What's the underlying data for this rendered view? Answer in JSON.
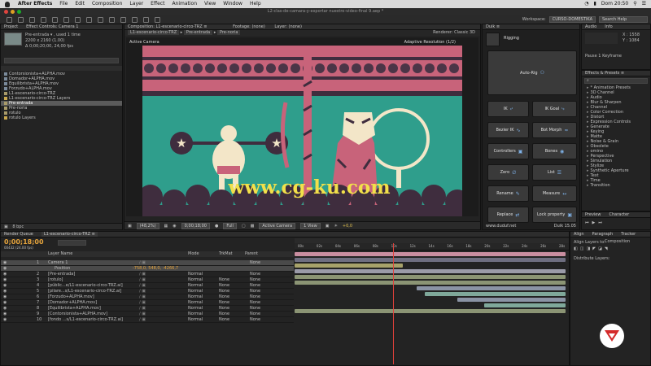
{
  "menubar": {
    "app": "After Effects",
    "items": [
      "File",
      "Edit",
      "Composition",
      "Layer",
      "Effect",
      "Animation",
      "View",
      "Window",
      "Help"
    ],
    "clock": "Dom 20:50"
  },
  "titlebar": {
    "title": "L2-clas-de-camara-y-exportar nuestro-video-final 9.aep *"
  },
  "toolbar": {
    "workspace_label": "Workspace:",
    "workspace_value": "CURSO-DOMESTIKA",
    "search_placeholder": "Search Help"
  },
  "project": {
    "tab_project": "Project",
    "tab_controls": "Effect Controls: Camera 1",
    "item_name": "Pre-entrada ▾ , used 1 time",
    "item_size": "2200 x 2160 (1.00)",
    "item_dur": "Δ 0;00;20;00, 24,00 fps",
    "items": [
      "Contorsionista+ALPHA.mov",
      "Domador+ALPHA.mov",
      "Equilibrista+ALPHA.mov",
      "Forzudo+ALPHA.mov",
      "L1-escenario-circo-TRZ",
      "L1-escenario-circo-TRZ Layers",
      "Pre-entrada",
      "Pre-noria",
      "rotulo",
      "rotulo Layers"
    ],
    "bpc": "8 bpc"
  },
  "comp": {
    "tab": "Composition: L1-escenario-circo-TRZ ≡",
    "tab2": "Footage: (none)",
    "tab3": "Layer: (none)",
    "breadcrumb1": "L1-escenario-circo-TRZ",
    "breadcrumb2": "Pre-entrada",
    "breadcrumb3": "Pre-noria",
    "renderer": "Renderer: Classic 3D",
    "active_camera": "Active Camera",
    "adaptive": "Adaptive Resolution (1/2)",
    "watermark": "www.cg-ku.com",
    "zoom": "(48,2%)",
    "timecode": "0;00;18;00",
    "quality": "Full",
    "view_camera": "Active Camera",
    "views": "1 View",
    "exposure": "+0,0"
  },
  "duik": {
    "tab": "Duik ≡",
    "section": "Rigging",
    "autorig": "Auto-Rig",
    "ik": "IK",
    "ikgoal": "IK Goal",
    "bezierik": "Bezier IK",
    "botmorph": "Bot Morph",
    "controllers": "Controllers",
    "bones": "Bones",
    "zero": "Zero",
    "list": "List",
    "rename": "Rename",
    "measure": "Measure",
    "replace": "Replace",
    "lockprop": "Lock property",
    "site": "www.duduf.net",
    "version": "Duik 15.05"
  },
  "info": {
    "tab_audio": "Audio",
    "tab_info": "Info",
    "x": "X : 1558",
    "y": "Y : 1084",
    "layer": "Pause 1 Keyframe"
  },
  "effects": {
    "tab": "Effects & Presets ≡",
    "search": "⌕",
    "categories": [
      "* Animation Presets",
      "3D Channel",
      "Audio",
      "Blur & Sharpen",
      "Channel",
      "Color Correction",
      "Distort",
      "Expression Controls",
      "Generate",
      "Keying",
      "Matte",
      "Noise & Grain",
      "Obsolete",
      "omino",
      "Perspective",
      "Simulation",
      "Stylize",
      "Synthetic Aperture",
      "Text",
      "Time",
      "Transition"
    ]
  },
  "preview": {
    "tab": "Preview",
    "tab2": "Character"
  },
  "align": {
    "tab": "Align",
    "tab2": "Paragraph",
    "tab3": "Tracker",
    "align_to": "Align Layers to:",
    "align_val": "Composition",
    "distribute": "Distribute Layers:"
  },
  "timeline": {
    "tab1": "Render Queue",
    "tab2": "L1-escenario-circo-TRZ ≡",
    "timecode": "0;00;18;00",
    "frames": "00432 (24.00 fps)",
    "col_layer": "Layer Name",
    "col_mode": "Mode",
    "col_trk": "TrkMat",
    "col_parent": "Parent",
    "ruler": [
      "00s",
      "02s",
      "04s",
      "06s",
      "08s",
      "10s",
      "12s",
      "14s",
      "16s",
      "18s",
      "20s",
      "22s",
      "24s",
      "26s",
      "28s"
    ],
    "layers": [
      {
        "num": "1",
        "name": "Camera 1",
        "mode": "",
        "trk": "",
        "parent": "None"
      },
      {
        "num": "",
        "name": "Position",
        "mode": "",
        "trk": "",
        "parent": "",
        "value": "-758,0, 548,0, -4266,7"
      },
      {
        "num": "2",
        "name": "[Pre-entrada]",
        "mode": "Normal",
        "trk": "",
        "parent": "None"
      },
      {
        "num": "3",
        "name": "[rotulo]",
        "mode": "Normal",
        "trk": "None",
        "parent": "None"
      },
      {
        "num": "4",
        "name": "[públic...e/L1-escenario-circo-TRZ.ai]",
        "mode": "Normal",
        "trk": "None",
        "parent": "None"
      },
      {
        "num": "5",
        "name": "[pilare...s/L1-escenario-circo-TRZ.ai]",
        "mode": "Normal",
        "trk": "None",
        "parent": "None"
      },
      {
        "num": "6",
        "name": "[Forzudo+ALPHA.mov]",
        "mode": "Normal",
        "trk": "None",
        "parent": "None"
      },
      {
        "num": "7",
        "name": "[Domador+ALPHA.mov]",
        "mode": "Normal",
        "trk": "None",
        "parent": "None"
      },
      {
        "num": "8",
        "name": "[Equilibrista+ALPHA.mov]",
        "mode": "Normal",
        "trk": "None",
        "parent": "None"
      },
      {
        "num": "9",
        "name": "[Contorsionista+ALPHA.mov]",
        "mode": "Normal",
        "trk": "None",
        "parent": "None"
      },
      {
        "num": "10",
        "name": "[fondo ...s/L1-escenario-circo-TRZ.ai]",
        "mode": "Normal",
        "trk": "None",
        "parent": "None"
      }
    ],
    "bar_ranges": [
      [
        0,
        100
      ],
      [
        0,
        100
      ],
      [
        0,
        40
      ],
      [
        0,
        100
      ],
      [
        0,
        100
      ],
      [
        0,
        100
      ],
      [
        45,
        100
      ],
      [
        48,
        100
      ],
      [
        60,
        100
      ],
      [
        70,
        100
      ],
      [
        0,
        100
      ]
    ],
    "bar_colors": [
      "#c98ea0",
      "#6e6e80",
      "#a7a26a",
      "#9a9aa8",
      "#8b9474",
      "#8b9474",
      "#8a93a4",
      "#7fa89a",
      "#8a93a4",
      "#7fa89a",
      "#8b9474"
    ],
    "playhead": 0.36
  },
  "colors": {
    "stage": "#2f9e8c",
    "top": "#c8637a",
    "dark": "#3f2d3e",
    "cream": "#f3e6c8",
    "watermark": "#f2e04a",
    "logo": "#d42a2a"
  }
}
